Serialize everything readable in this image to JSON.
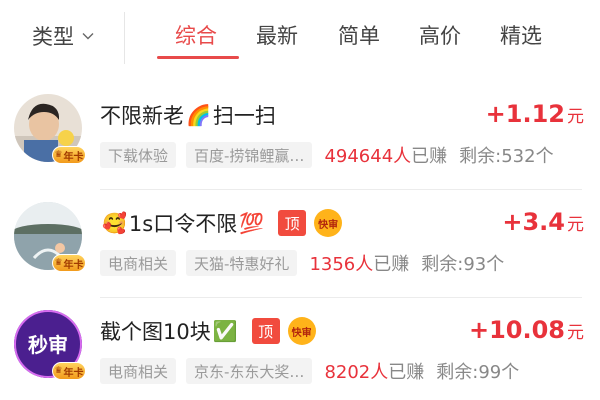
{
  "filter": {
    "type_label": "类型"
  },
  "tabs": [
    {
      "label": "综合",
      "active": true
    },
    {
      "label": "最新",
      "active": false
    },
    {
      "label": "简单",
      "active": false
    },
    {
      "label": "高价",
      "active": false
    },
    {
      "label": "精选",
      "active": false
    }
  ],
  "colors": {
    "accent": "#e84a4a",
    "reward": "#e8323b",
    "chip_bg": "#f3f3f3"
  },
  "tasks": [
    {
      "title_text": "不限新老",
      "title_emoji": "🌈",
      "title_suffix": "扫一扫",
      "reward_amount": "+1.12",
      "reward_unit": "元",
      "category": "下载体验",
      "store": "百度-捞锦鲤赢…",
      "earned_count": "494644人",
      "earned_label": "已赚",
      "remaining": "剩余:532个",
      "vip_label": "年卡",
      "avatar_icon": "person-photo"
    },
    {
      "title_emoji_prefix": "🥰",
      "title_text": "1s口令不限",
      "title_emoji": "💯",
      "tag_top": "顶",
      "tag_kuai": "快审",
      "reward_amount": "+3.4",
      "reward_unit": "元",
      "category": "电商相关",
      "store": "天猫-特惠好礼",
      "earned_count": "1356人",
      "earned_label": "已赚",
      "remaining": "剩余:93个",
      "vip_label": "年卡",
      "avatar_icon": "landscape-photo"
    },
    {
      "title_text": "截个图10块",
      "title_emoji": "✅",
      "tag_top": "顶",
      "tag_kuai": "快审",
      "reward_amount": "+10.08",
      "reward_unit": "元",
      "category": "电商相关",
      "store": "京东-东东大奖…",
      "earned_count": "8202人",
      "earned_label": "已赚",
      "remaining": "剩余:99个",
      "vip_label": "年卡",
      "avatar_text": "秒审",
      "avatar_icon": "miaoshen-logo"
    }
  ]
}
